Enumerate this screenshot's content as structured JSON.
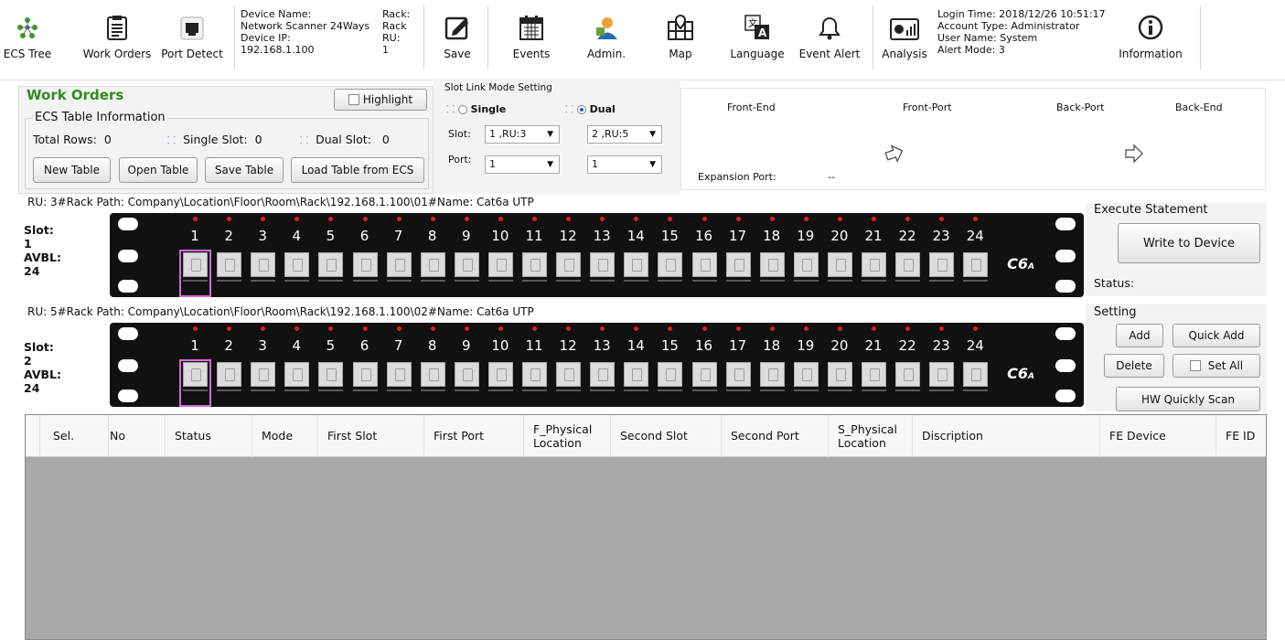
{
  "toolbar": {
    "buttons": [
      {
        "label": "ECS Tree",
        "icon": "ecs-tree-icon"
      },
      {
        "label": "Work Orders",
        "icon": "clipboard-icon"
      },
      {
        "label": "Port Detect",
        "icon": "port-detect-icon"
      },
      {
        "label": "Save",
        "icon": "edit-save-icon"
      },
      {
        "label": "Events",
        "icon": "calendar-icon"
      },
      {
        "label": "Admin.",
        "icon": "admin-user-icon"
      },
      {
        "label": "Map",
        "icon": "map-icon"
      },
      {
        "label": "Language",
        "icon": "language-icon"
      },
      {
        "label": "Event Alert",
        "icon": "bell-icon"
      },
      {
        "label": "Analysis",
        "icon": "analysis-chart-icon"
      },
      {
        "label": "Information",
        "icon": "info-icon"
      }
    ],
    "device": {
      "name_label": "Device Name:",
      "name_value": "Network Scanner 24Ways",
      "ip_label": "Device IP:",
      "ip_value": "192.168.1.100",
      "rack_label": "Rack:",
      "rack_value": "Rack",
      "ru_label": "RU:",
      "ru_value": "1"
    },
    "login": {
      "time": "Login Time: 2018/12/26 10:51:17",
      "account": "Account Type: Administrator",
      "user": "User Name: System",
      "alert": "Alert Mode: 3"
    }
  },
  "work_orders": {
    "title": "Work Orders",
    "highlight_label": "Highlight",
    "ecs_group_title": "ECS Table Information",
    "total_rows_label": "Total Rows:",
    "total_rows_value": "0",
    "single_slot_label": "Single Slot:",
    "single_slot_value": "0",
    "dual_slot_label": "Dual Slot:",
    "dual_slot_value": "0",
    "buttons": {
      "new_table": "New Table",
      "open_table": "Open Table",
      "save_table": "Save Table",
      "load_table": "Load Table from ECS"
    }
  },
  "slot_link": {
    "title": "Slot Link Mode Setting",
    "single_label": "Single",
    "dual_label": "Dual",
    "selected_mode": "Dual",
    "slot_label": "Slot:",
    "port_label": "Port:",
    "slot1_value": "1 ,RU:3",
    "slot2_value": "2 ,RU:5",
    "port1_value": "1",
    "port2_value": "1"
  },
  "link_panel": {
    "front_end": "Front-End",
    "front_port": "Front-Port",
    "back_port": "Back-Port",
    "back_end": "Back-End",
    "expansion_label": "Expansion Port:",
    "expansion_value": "--"
  },
  "racks": [
    {
      "path": "RU: 3#Rack Path: Company\\Location\\Floor\\Room\\Rack\\192.168.1.100\\01#Name: Cat6a UTP",
      "slot_label": "Slot:",
      "slot_value": "1",
      "avbl_label": "AVBL:",
      "avbl_value": "24",
      "selected_port": 1
    },
    {
      "path": "RU: 5#Rack Path: Company\\Location\\Floor\\Room\\Rack\\192.168.1.100\\02#Name: Cat6a UTP",
      "slot_label": "Slot:",
      "slot_value": "2",
      "avbl_label": "AVBL:",
      "avbl_value": "24",
      "selected_port": 1
    }
  ],
  "port_numbers": [
    "1",
    "2",
    "3",
    "4",
    "5",
    "6",
    "7",
    "8",
    "9",
    "10",
    "11",
    "12",
    "13",
    "14",
    "15",
    "16",
    "17",
    "18",
    "19",
    "20",
    "21",
    "22",
    "23",
    "24"
  ],
  "panel_brand": "C6",
  "panel_brand_sub": "A",
  "execute": {
    "title": "Execute Statement",
    "write_button": "Write to Device",
    "status_label": "Status:"
  },
  "setting": {
    "title": "Setting",
    "add": "Add",
    "quick_add": "Quick Add",
    "delete": "Delete",
    "set_all": "Set All",
    "hw_scan": "HW Quickly Scan"
  },
  "table": {
    "columns": [
      "Sel.",
      "No",
      "Status",
      "Mode",
      "First Slot",
      "First Port",
      "F_Physical\nLocation",
      "Second Slot",
      "Second Port",
      "S_Physical\nLocation",
      "Discription",
      "FE Device",
      "FE ID"
    ],
    "rows": []
  }
}
